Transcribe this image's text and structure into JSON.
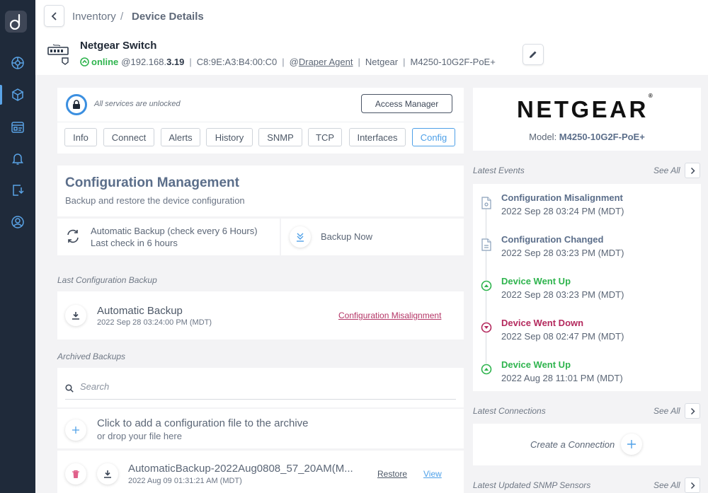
{
  "breadcrumb": {
    "root": "Inventory",
    "separator": "/",
    "current": "Device Details"
  },
  "device": {
    "name": "Netgear Switch",
    "status": "online",
    "ip_prefix": "@192.168.",
    "ip_suffix": "3.19",
    "mac": "C8:9E:A3:B4:00:C0",
    "agent_prefix": "@",
    "agent": "Draper Agent",
    "vendor": "Netgear",
    "model": "M4250-10G2F-PoE+"
  },
  "services": {
    "status_text": "All services are unlocked",
    "access_button": "Access Manager"
  },
  "tabs": [
    {
      "label": "Info"
    },
    {
      "label": "Connect"
    },
    {
      "label": "Alerts"
    },
    {
      "label": "History"
    },
    {
      "label": "SNMP"
    },
    {
      "label": "TCP"
    },
    {
      "label": "Interfaces"
    },
    {
      "label": "Config",
      "active": true
    }
  ],
  "config": {
    "title": "Configuration Management",
    "subtitle": "Backup and restore the device configuration",
    "auto_backup": "Automatic Backup (check every 6 Hours)",
    "last_check": "Last check in 6 hours",
    "backup_now": "Backup Now"
  },
  "last_backup": {
    "section_label": "Last Configuration Backup",
    "title": "Automatic Backup",
    "date": "2022 Sep 28 03:24:00 PM (MDT)",
    "link": "Configuration Misalignment"
  },
  "archived": {
    "section_label": "Archived Backups",
    "search_placeholder": "Search",
    "add_line1": "Click to add a configuration file to the archive",
    "add_line2": "or drop your file here",
    "file_name": "AutomaticBackup-2022Aug0808_57_20AM(M...",
    "file_date": "2022 Aug 09 01:31:21 AM (MDT)",
    "restore": "Restore",
    "view": "View"
  },
  "vendor_card": {
    "logo_text": "NETGEAR",
    "logo_mark": "®",
    "model_prefix": "Model: ",
    "model": "M4250-10G2F-PoE+"
  },
  "events": {
    "label": "Latest Events",
    "see_all": "See All",
    "items": [
      {
        "title": "Configuration Misalignment",
        "date": "2022 Sep 28 03:24 PM (MDT)",
        "type": "config",
        "color": "#5b6e8a"
      },
      {
        "title": "Configuration Changed",
        "date": "2022 Sep 28 03:23 PM (MDT)",
        "type": "config",
        "color": "#5b6e8a"
      },
      {
        "title": "Device Went Up",
        "date": "2022 Sep 28 03:23 PM (MDT)",
        "type": "up",
        "color": "#2fb44e"
      },
      {
        "title": "Device Went Down",
        "date": "2022 Sep 08 02:47 PM (MDT)",
        "type": "down",
        "color": "#b42a5e"
      },
      {
        "title": "Device Went Up",
        "date": "2022 Aug 28 11:01 PM (MDT)",
        "type": "up",
        "color": "#2fb44e"
      }
    ]
  },
  "connections": {
    "label": "Latest Connections",
    "see_all": "See All",
    "create": "Create a Connection"
  },
  "snmp": {
    "label": "Latest Updated SNMP Sensors",
    "see_all": "See All"
  },
  "colors": {
    "sidebar_bg": "#1f2a3a",
    "accent": "#4ea0e8",
    "online": "#2fb44e",
    "alert": "#b42a5e"
  }
}
